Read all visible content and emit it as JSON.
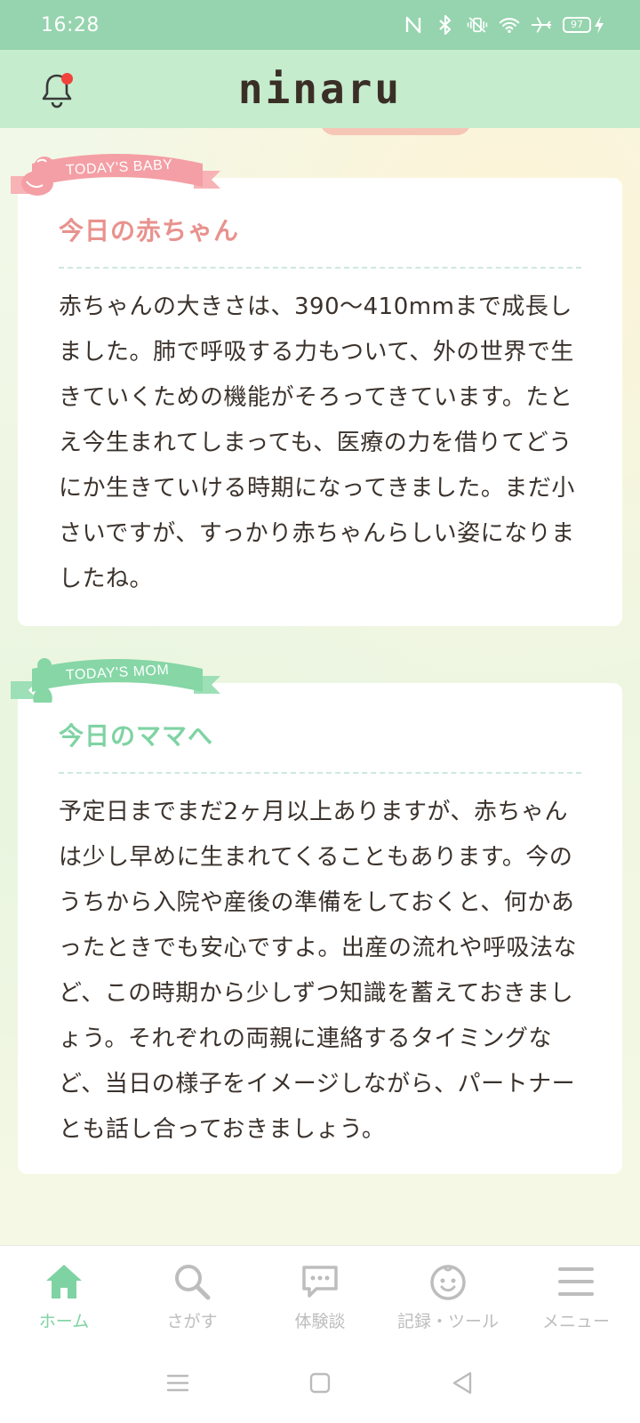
{
  "status_bar": {
    "time": "16:28",
    "battery": "97",
    "icons": [
      "nfc-icon",
      "bluetooth-icon",
      "vibrate-icon",
      "wifi-icon",
      "airplane-icon",
      "battery-icon",
      "charging-icon"
    ]
  },
  "header": {
    "logo": "ninaru",
    "notification_icon": "bell-icon",
    "has_notification": true
  },
  "baby_card": {
    "ribbon": "TODAY'S BABY",
    "title": "今日の赤ちゃん",
    "body": "赤ちゃんの大きさは、390〜410mmまで成長しました。肺で呼吸する力もついて、外の世界で生きていくための機能がそろってきています。たとえ今生まれてしまっても、医療の力を借りてどうにか生きていける時期になってきました。まだ小さいですが、すっかり赤ちゃんらしい姿になりましたね。"
  },
  "mom_card": {
    "ribbon": "TODAY'S MOM",
    "title": "今日のママへ",
    "body": "予定日までまだ2ヶ月以上ありますが、赤ちゃんは少し早めに生まれてくることもあります。今のうちから入院や産後の準備をしておくと、何かあったときでも安心ですよ。出産の流れや呼吸法など、この時期から少しずつ知識を蓄えておきましょう。それぞれの両親に連絡するタイミングなど、当日の様子をイメージしながら、パートナーとも話し合っておきましょう。"
  },
  "bottom_nav": {
    "items": [
      {
        "label": "ホーム",
        "icon": "home-icon",
        "active": true
      },
      {
        "label": "さがす",
        "icon": "search-icon",
        "active": false
      },
      {
        "label": "体験談",
        "icon": "chat-icon",
        "active": false
      },
      {
        "label": "記録・ツール",
        "icon": "baby-face-icon",
        "active": false
      },
      {
        "label": "メニュー",
        "icon": "menu-icon",
        "active": false
      }
    ]
  },
  "colors": {
    "status_bar": "#95d4ae",
    "header": "#c6ecce",
    "baby_accent": "#e8928e",
    "mom_accent": "#7fd3a3",
    "notification_dot": "#f0433c"
  }
}
